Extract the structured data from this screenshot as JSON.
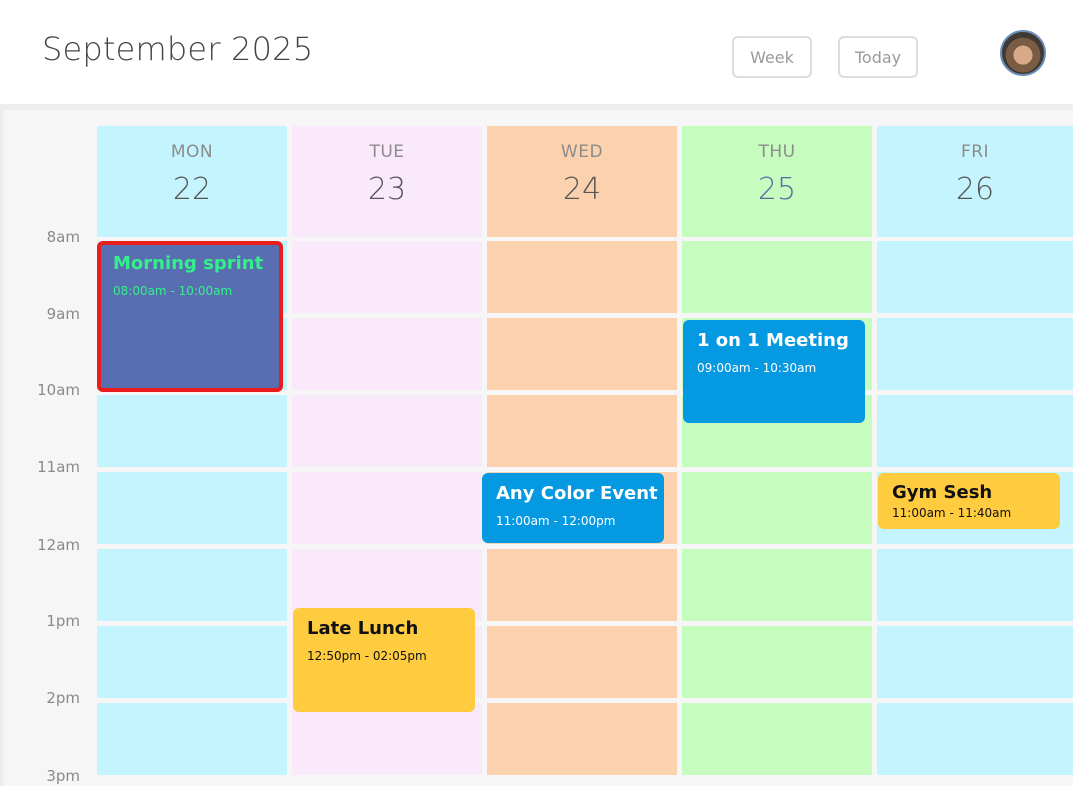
{
  "header": {
    "title": "September 2025",
    "buttons": {
      "week": "Week",
      "today": "Today"
    },
    "avatar_icon": "user-avatar"
  },
  "time_labels": [
    "8am",
    "9am",
    "10am",
    "11am",
    "12am",
    "1pm",
    "2pm",
    "3pm"
  ],
  "days": [
    {
      "dow": "MON",
      "date": "22",
      "color": "#c4f4fd"
    },
    {
      "dow": "TUE",
      "date": "23",
      "color": "#f9e9fa"
    },
    {
      "dow": "WED",
      "date": "24",
      "color": "#fcd2ae"
    },
    {
      "dow": "THU",
      "date": "25",
      "color": "#c6fcbe",
      "highlight": "#5b6aa8"
    },
    {
      "dow": "FRI",
      "date": "26",
      "color": "#c4f4fd"
    }
  ],
  "events": [
    {
      "title": "Morning sprint",
      "time": "08:00am - 10:00am",
      "bg": "#586eb0",
      "fg": "#34f08a",
      "selected": true,
      "selected_border": "#ea1c1c"
    },
    {
      "title": "1 on 1 Meeting",
      "time": "09:00am - 10:30am",
      "bg": "#0599e2",
      "fg": "#ffffff"
    },
    {
      "title": "Any Color Event",
      "time": "11:00am - 12:00pm",
      "bg": "#0599e2",
      "fg": "#ffffff"
    },
    {
      "title": "Gym Sesh",
      "time": "11:00am - 11:40am",
      "bg": "#ffcc40",
      "fg": "#111111"
    },
    {
      "title": "Late Lunch",
      "time": "12:50pm - 02:05pm",
      "bg": "#ffcc40",
      "fg": "#111111"
    }
  ]
}
